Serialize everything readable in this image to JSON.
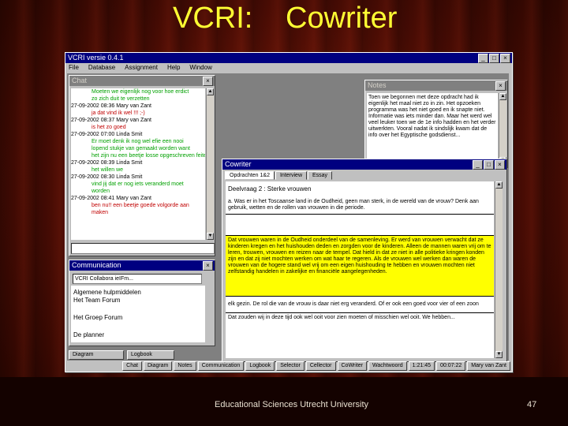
{
  "slide": {
    "title_left": "VCRI:",
    "title_right": "Cowriter",
    "footer": "Educational Sciences Utrecht University",
    "page": "47"
  },
  "app": {
    "title": "VCRI versie 0.4.1",
    "menu": [
      "File",
      "Database",
      "Assignment",
      "Help",
      "Window"
    ]
  },
  "chat": {
    "title": "Chat",
    "lines": [
      {
        "text": "Moeten we eigenlijk nog voor hoe erdict",
        "color": "g"
      },
      {
        "text": "zo zich duit te verzetten",
        "color": "g"
      },
      {
        "text": "27-09-2002 08:36 Mary van Zant",
        "color": "k"
      },
      {
        "text": "ja dat vind ik wel !!! ;-)",
        "color": "r"
      },
      {
        "text": "27-09-2002 08:37 Mary van Zant",
        "color": "k"
      },
      {
        "text": "is het zo goed",
        "color": "r"
      },
      {
        "text": "27-09-2002 07:00 Linda Smit",
        "color": "k"
      },
      {
        "text": "Er moet denk ik nog wel efie een nooi",
        "color": "g"
      },
      {
        "text": "lopend stukje van gemaakt worden want",
        "color": "g"
      },
      {
        "text": "het zijn nu een beetje losse opgeschreven feiten",
        "color": "g"
      },
      {
        "text": "27-09-2002 08:39 Linda Smit",
        "color": "k"
      },
      {
        "text": "het willen we",
        "color": "g"
      },
      {
        "text": "27-09-2002 08:30 Linda Smit",
        "color": "k"
      },
      {
        "text": "vind jij dat er nog iets veranderd moet",
        "color": "g"
      },
      {
        "text": "worden",
        "color": "g"
      },
      {
        "text": "27-09-2002 08:41 Mary van Zant",
        "color": "k"
      },
      {
        "text": "ben nu!! een beetje goede volgorde aan",
        "color": "r"
      },
      {
        "text": "maken",
        "color": "r"
      }
    ]
  },
  "notes": {
    "title": "Notes",
    "text": "Toen we begonnen met deze opdracht had ik eigenlijk het maal niet zo in zin. Het opzoeken programma was het niet goed en ik snapte niet. Informatie was iets minder dan. Maar het werd wel veel leuker toen we de 1e info hadden en het verder uitwerkten. Vooral nadat ik sindslijk kwam dat de info over het Egyptische godsdienst..."
  },
  "communication": {
    "title": "Communication",
    "select": "VCRI Collabora ieIFm...",
    "items": [
      "Algemene hulpmiddelen",
      "Het Team Forum",
      "Het Groep Forum",
      "De planner"
    ]
  },
  "cowriter": {
    "title": "Cowriter",
    "tabs": [
      "Opdrachten 1&2",
      "Interview",
      "Essay"
    ],
    "heading": "Deelvraag 2 : Sterke vrouwen",
    "question": "a. Was er in het Toscaanse land in de Oudheid, geen man sterk, in de wereld van de vrouw? Denk aan gebruik, wetten en de rollen van vrouwen in die periode.",
    "yellow": "Dat vrouwen waren in de Oudheid onderdeel van de samenleving. Er werd van vrouwen verwacht dat ze kinderen kregen en het huishouden deden en zorgden voor de kinderen. Alleen de mannen waren vrij om te leren, trouwen, vrouwen en reizen naar de tempel. Dat hield in dat ze niet in alle politieke kringen konden zijn en dat zij niet mochten werken om wat haar te regeren. Als de vrouwen wel werken dan waren de vrouwen van de hogere stand wel vrij om een eigen huishouding te hebben en vrouwen mochten niet zelfstandig handelen in zakelijke en financiële aangelegenheden.",
    "after1": "elk gezin. De rol die van de vrouw is daar niet erg veranderd. Of er ook een goed voor vier of een zoon",
    "after2": "Dat zouden wij in deze tijd ook wel ooit voor zien moeten of misschien wel ooit. We hebben..."
  },
  "status": [
    "Chat",
    "Diagram",
    "Notes",
    "Communication",
    "Logbook",
    "Selector",
    "Cellector",
    "CoWriter",
    "Wachtwoord",
    "1:21:45",
    "00:07:22",
    "Mary van Zant"
  ],
  "bottom_tabs": [
    "Diagram",
    "Logbook"
  ]
}
